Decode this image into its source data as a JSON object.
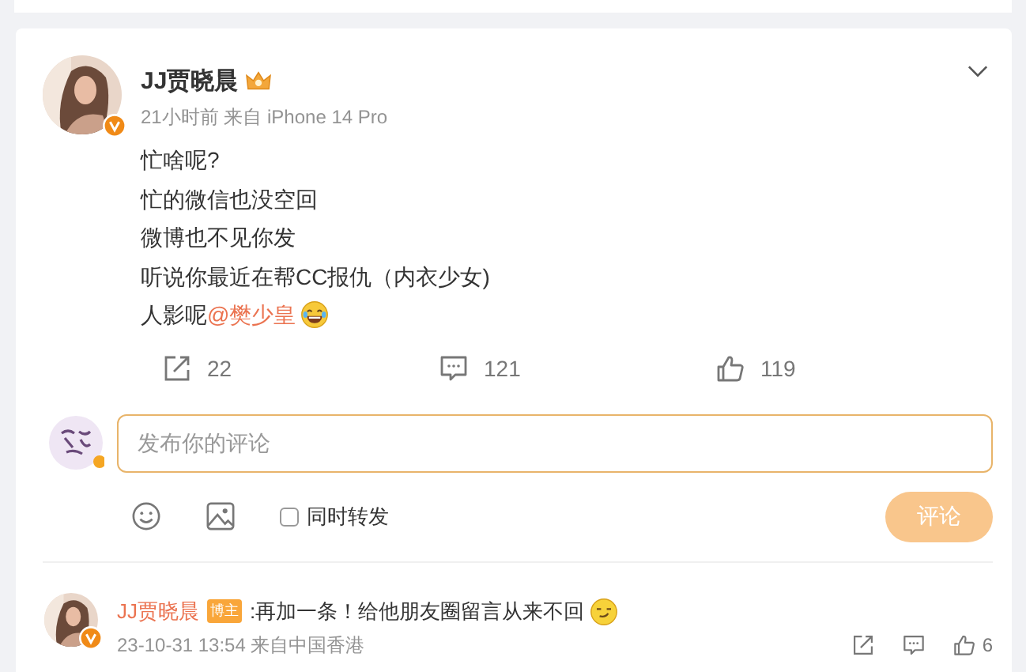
{
  "post": {
    "author": {
      "name": "JJ贾晓晨",
      "verified": true,
      "crown": true
    },
    "meta": "21小时前 来自 iPhone 14 Pro",
    "lines": [
      {
        "text": "忙啥呢?"
      },
      {
        "text": "忙的微信也没空回"
      },
      {
        "text": "微博也不见你发"
      },
      {
        "text": "听说你最近在帮CC报仇（内衣少女)"
      },
      {
        "segments": [
          {
            "kind": "text",
            "text": "人影呢"
          },
          {
            "kind": "mention",
            "text": "@樊少皇"
          },
          {
            "kind": "laugh_emoji"
          }
        ]
      }
    ],
    "actions": [
      {
        "kind": "repost",
        "count": "22"
      },
      {
        "kind": "comment",
        "count": "121"
      },
      {
        "kind": "like",
        "count": "119"
      }
    ]
  },
  "composer": {
    "placeholder": "发布你的评论",
    "repost_checkbox": {
      "label": "同时转发",
      "checked": false
    },
    "submit": {
      "label": "评论",
      "disabled": true
    }
  },
  "comment": {
    "author": "JJ贾晓晨",
    "verified": true,
    "badge": "博主",
    "segments": [
      {
        "kind": "text",
        "text": ":再加一条！给他朋友圈留言从来不回"
      },
      {
        "kind": "smirk_emoji"
      }
    ],
    "meta": "23-10-31 13:54 来自中国香港",
    "actions": [
      {
        "kind": "repost"
      },
      {
        "kind": "comment"
      },
      {
        "kind": "like",
        "count": "6"
      }
    ]
  }
}
